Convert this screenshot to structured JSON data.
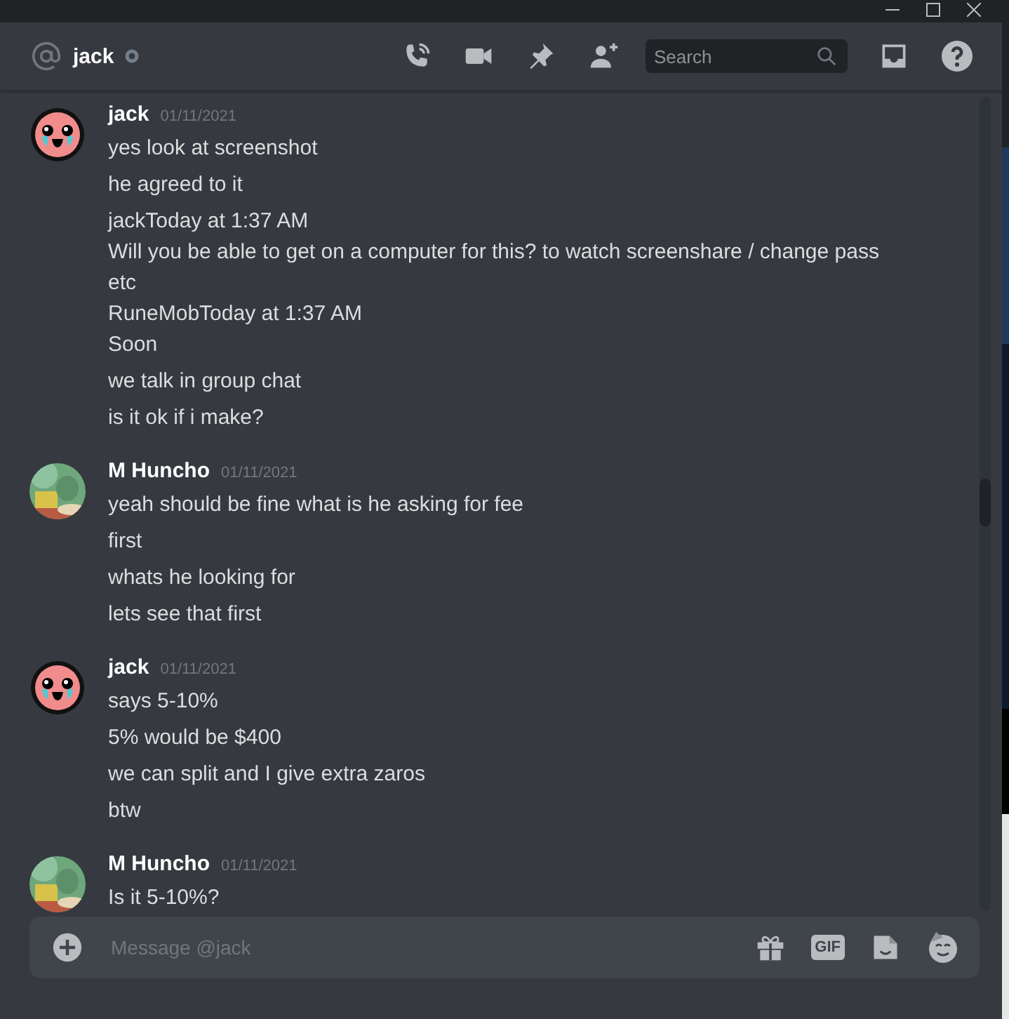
{
  "header": {
    "title": "jack",
    "status": {
      "kind": "offline"
    },
    "search": {
      "placeholder": "Search"
    }
  },
  "messages": [
    {
      "author": "jack",
      "avatar": {
        "kind": "face"
      },
      "time": "01/11/2021",
      "lines": [
        "yes look at screenshot",
        "he agreed to it",
        "jackToday at 1:37 AM\nWill you be able to get on a computer for this? to watch screenshare / change pass etc\nRuneMobToday at 1:37 AM\nSoon",
        "we talk in group chat",
        "is it ok if i make?"
      ]
    },
    {
      "author": "M Huncho",
      "avatar": {
        "kind": "picture"
      },
      "time": "01/11/2021",
      "lines": [
        "yeah should be fine what is he asking for fee",
        "first",
        "whats he looking for",
        "lets see that first"
      ]
    },
    {
      "author": "jack",
      "avatar": {
        "kind": "face"
      },
      "time": "01/11/2021",
      "lines": [
        "says 5-10%",
        "5% would be $400",
        "we can split and I give extra zaros",
        "btw"
      ]
    },
    {
      "author": "M Huncho",
      "avatar": {
        "kind": "picture"
      },
      "time": "01/11/2021",
      "lines": [
        "Is it 5-10%?"
      ]
    }
  ],
  "composer": {
    "placeholder": "Message @jack",
    "gif_label": "GIF"
  }
}
